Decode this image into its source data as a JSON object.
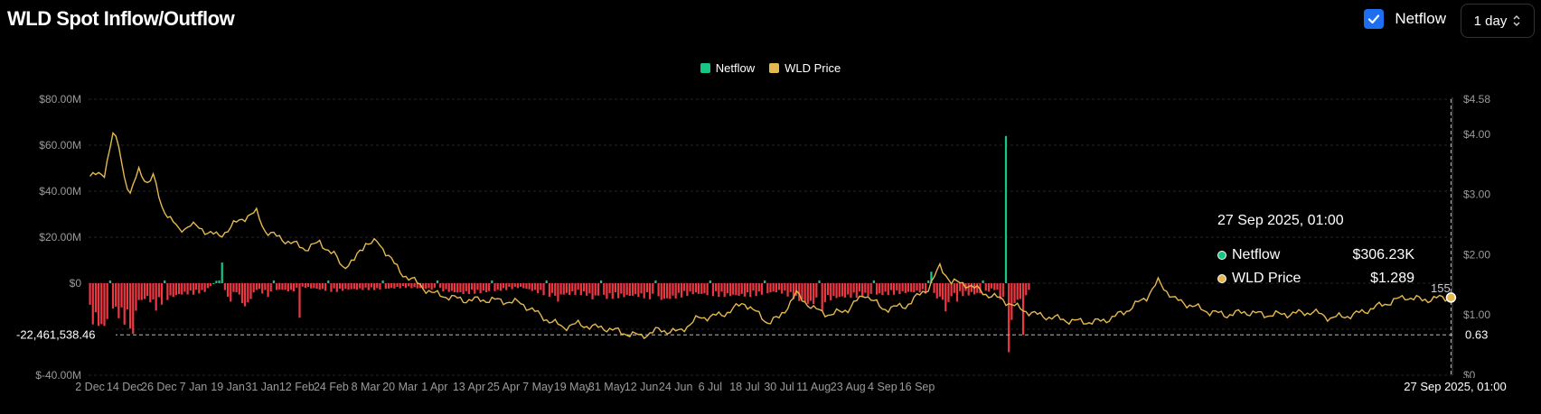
{
  "header": {
    "title": "WLD Spot Inflow/Outflow",
    "netflow_toggle_label": "Netflow",
    "netflow_checked": true,
    "interval_value": "1 day"
  },
  "colors": {
    "inflow": "#16c784",
    "outflow": "#ea3943",
    "price": "#e5b94f",
    "accent": "#1e6ff0"
  },
  "tooltip": {
    "title": "27 Sep 2025, 01:00",
    "rows": [
      {
        "label": "Netflow",
        "value": "$306.23K"
      },
      {
        "label": "WLD Price",
        "value": "$1.289"
      }
    ]
  },
  "crosshair": {
    "left_label": "-22,461,538.46",
    "right_label": "0.63",
    "bottom_label": "27 Sep 2025, 01:00",
    "netflow_value": -22461538.46,
    "price_value": 0.63
  },
  "partial_label": "155",
  "chart_data": {
    "type": "bar+line",
    "title": "WLD Spot Inflow/Outflow",
    "legend": [
      "Netflow",
      "WLD Price"
    ],
    "legend_position": "top-center",
    "grid": true,
    "x_tick_labels": [
      "2 Dec",
      "14 Dec",
      "26 Dec",
      "7 Jan",
      "19 Jan",
      "31 Jan",
      "12 Feb",
      "24 Feb",
      "8 Mar",
      "20 Mar",
      "1 Apr",
      "13 Apr",
      "25 Apr",
      "7 May",
      "19 May",
      "31 May",
      "12 Jun",
      "24 Jun",
      "6 Jul",
      "18 Jul",
      "30 Jul",
      "11 Aug",
      "23 Aug",
      "4 Sep",
      "16 Sep"
    ],
    "y_left": {
      "label": "Netflow",
      "min": -40000000,
      "max": 80000000,
      "ticks": [
        "$80.00M",
        "$60.00M",
        "$40.00M",
        "$20.00M",
        "$0",
        "$-40.00M"
      ]
    },
    "y_right": {
      "label": "WLD Price",
      "min": 0,
      "max": 4.58,
      "ticks": [
        "$4.58",
        "$4.00",
        "$3.00",
        "$2.00",
        "$1.00",
        "$0"
      ]
    },
    "netflow_anchors": [
      [
        0,
        -17
      ],
      [
        3,
        -20
      ],
      [
        5,
        -26
      ],
      [
        7,
        -10
      ],
      [
        9,
        -14
      ],
      [
        11,
        -17
      ],
      [
        14,
        -20
      ],
      [
        17,
        -9
      ],
      [
        20,
        -7
      ],
      [
        23,
        -12
      ],
      [
        26,
        -8
      ],
      [
        30,
        -6
      ],
      [
        33,
        -5
      ],
      [
        36,
        -5
      ],
      [
        40,
        -4
      ],
      [
        46,
        4
      ],
      [
        48,
        -10
      ],
      [
        51,
        -4
      ],
      [
        54,
        -12
      ],
      [
        58,
        -3
      ],
      [
        62,
        -6
      ],
      [
        66,
        -3
      ],
      [
        70,
        -4
      ],
      [
        75,
        -2
      ],
      [
        80,
        -3
      ],
      [
        85,
        -4
      ],
      [
        90,
        -3
      ],
      [
        100,
        -3
      ],
      [
        110,
        -2
      ],
      [
        120,
        -3
      ],
      [
        130,
        -5
      ],
      [
        140,
        -4
      ],
      [
        150,
        -2
      ],
      [
        160,
        -6
      ],
      [
        170,
        -5
      ],
      [
        180,
        -7
      ],
      [
        190,
        -6
      ],
      [
        200,
        -8
      ],
      [
        210,
        -5
      ],
      [
        220,
        -6
      ],
      [
        230,
        -6
      ],
      [
        240,
        -4
      ],
      [
        250,
        -10
      ],
      [
        260,
        -7
      ],
      [
        270,
        -6
      ],
      [
        280,
        -5
      ],
      [
        290,
        -4
      ],
      [
        300,
        -6
      ],
      [
        310,
        -5
      ],
      [
        315,
        -3
      ],
      [
        318,
        -9
      ],
      [
        320,
        -25
      ],
      [
        322,
        -10
      ],
      [
        325,
        -6
      ],
      [
        328,
        -4
      ],
      [
        298,
        -14
      ],
      [
        297,
        -8
      ]
    ],
    "netflow_spikes": [
      [
        3,
        -22.5
      ],
      [
        8,
        -11
      ],
      [
        15,
        -22
      ],
      [
        46,
        9
      ],
      [
        73,
        -15
      ],
      [
        163,
        -8
      ],
      [
        175,
        -7
      ],
      [
        255,
        -12
      ],
      [
        293,
        5
      ],
      [
        302,
        -8
      ],
      [
        320,
        -30
      ],
      [
        319,
        64
      ],
      [
        325,
        -22.46
      ]
    ],
    "price_anchors": [
      [
        0,
        3.3
      ],
      [
        5,
        3.35
      ],
      [
        8,
        4.0
      ],
      [
        10,
        3.8
      ],
      [
        12,
        3.3
      ],
      [
        14,
        3.0
      ],
      [
        17,
        3.4
      ],
      [
        20,
        3.2
      ],
      [
        22,
        3.3
      ],
      [
        25,
        2.8
      ],
      [
        28,
        2.6
      ],
      [
        31,
        2.4
      ],
      [
        35,
        2.5
      ],
      [
        40,
        2.4
      ],
      [
        45,
        2.3
      ],
      [
        50,
        2.5
      ],
      [
        55,
        2.65
      ],
      [
        58,
        2.7
      ],
      [
        61,
        2.4
      ],
      [
        65,
        2.3
      ],
      [
        70,
        2.2
      ],
      [
        75,
        2.1
      ],
      [
        80,
        2.2
      ],
      [
        85,
        2.0
      ],
      [
        88,
        1.8
      ],
      [
        92,
        1.9
      ],
      [
        96,
        2.2
      ],
      [
        100,
        2.2
      ],
      [
        104,
        2.0
      ],
      [
        108,
        1.7
      ],
      [
        112,
        1.6
      ],
      [
        116,
        1.45
      ],
      [
        120,
        1.35
      ],
      [
        130,
        1.25
      ],
      [
        140,
        1.25
      ],
      [
        150,
        1.2
      ],
      [
        160,
        0.9
      ],
      [
        165,
        0.8
      ],
      [
        170,
        0.85
      ],
      [
        175,
        0.8
      ],
      [
        180,
        0.78
      ],
      [
        186,
        0.7
      ],
      [
        192,
        0.65
      ],
      [
        198,
        0.75
      ],
      [
        205,
        0.72
      ],
      [
        212,
        0.95
      ],
      [
        220,
        1.0
      ],
      [
        228,
        1.2
      ],
      [
        236,
        0.88
      ],
      [
        240,
        0.95
      ],
      [
        246,
        1.35
      ],
      [
        252,
        1.1
      ],
      [
        258,
        1.0
      ],
      [
        264,
        1.1
      ],
      [
        270,
        1.35
      ],
      [
        276,
        1.1
      ],
      [
        284,
        1.15
      ],
      [
        292,
        1.45
      ],
      [
        296,
        1.8
      ],
      [
        300,
        1.55
      ],
      [
        306,
        1.5
      ],
      [
        312,
        1.35
      ],
      [
        318,
        1.25
      ],
      [
        324,
        1.1
      ],
      [
        330,
        1.0
      ],
      [
        336,
        0.95
      ],
      [
        342,
        0.9
      ],
      [
        350,
        0.88
      ],
      [
        356,
        0.95
      ],
      [
        362,
        1.1
      ],
      [
        368,
        1.3
      ],
      [
        372,
        1.55
      ],
      [
        378,
        1.25
      ],
      [
        384,
        1.15
      ],
      [
        390,
        1.05
      ],
      [
        396,
        1.0
      ],
      [
        402,
        1.05
      ],
      [
        410,
        1.0
      ],
      [
        418,
        1.02
      ],
      [
        426,
        1.05
      ],
      [
        432,
        0.95
      ],
      [
        440,
        1.0
      ],
      [
        446,
        1.1
      ],
      [
        452,
        1.2
      ],
      [
        458,
        1.3
      ],
      [
        464,
        1.25
      ],
      [
        470,
        1.28
      ],
      [
        474,
        1.289
      ]
    ]
  }
}
